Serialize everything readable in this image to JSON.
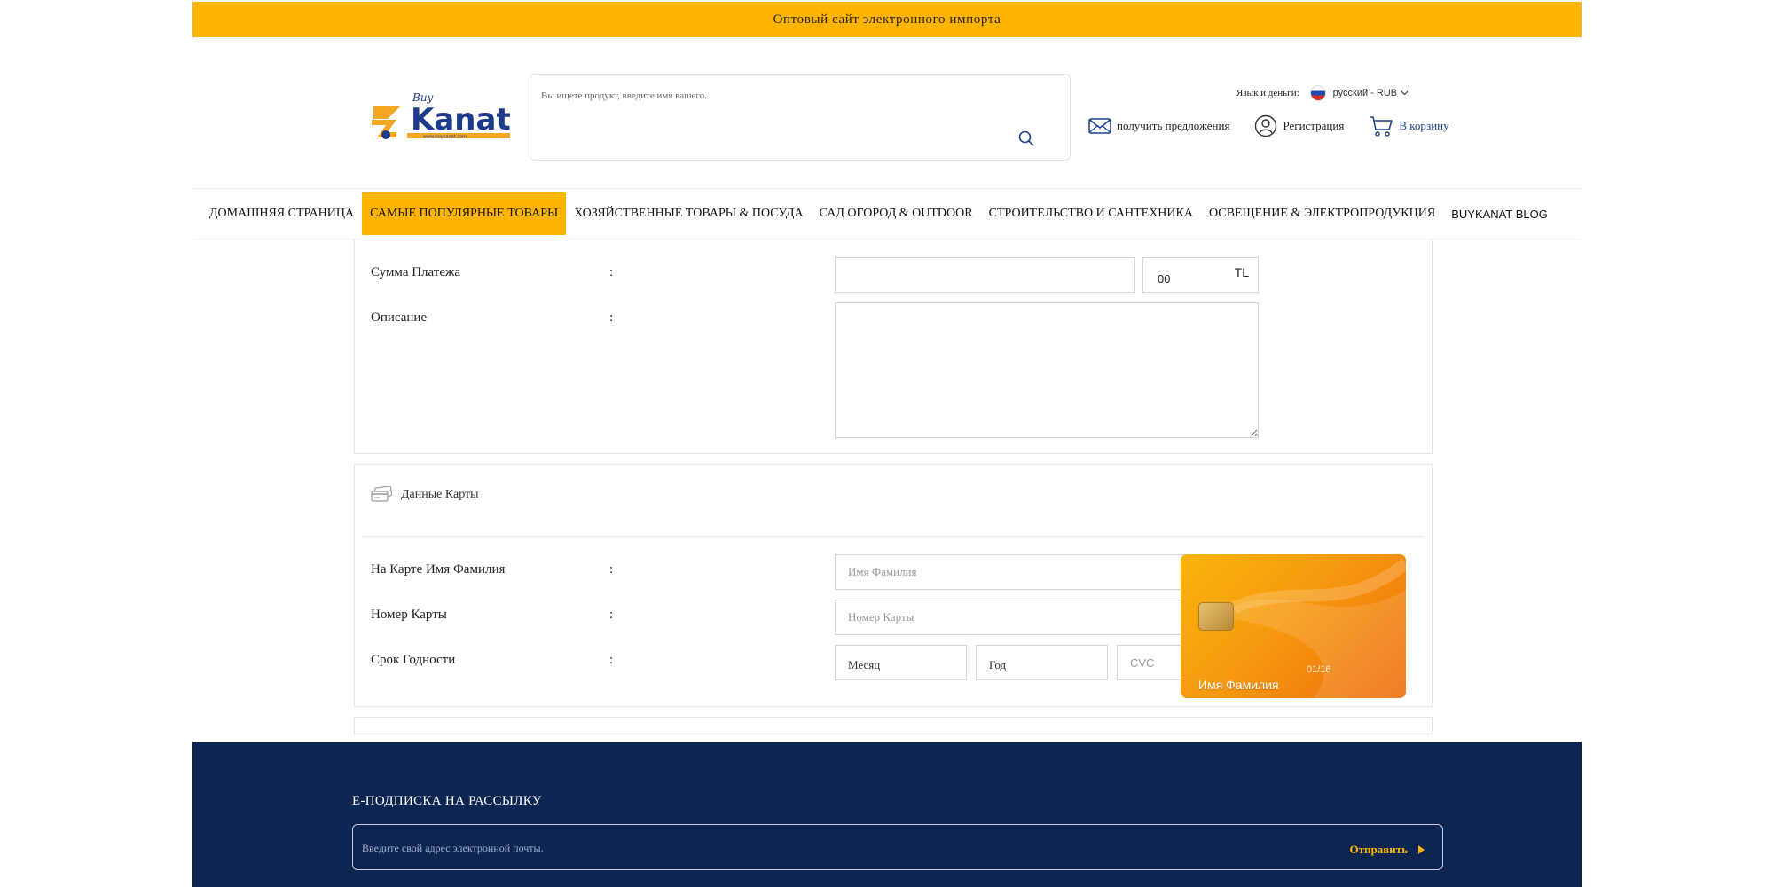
{
  "topbar": {
    "text": "Оптовый сайт электронного импорта"
  },
  "logo": {
    "buy": "Buy",
    "name": "Kanat",
    "site": "www.buykanat.com"
  },
  "search": {
    "placeholder": "Вы ищете продукт, введите имя вашего."
  },
  "lang": {
    "label": "Язык и деньги:",
    "current": "русский - RUB"
  },
  "header_links": {
    "offers": "получить предложения",
    "register": "Регистрация",
    "cart": "В корзину"
  },
  "nav": {
    "items": [
      "ДОМАШНЯЯ СТРАНИЦА",
      "САМЫЕ ПОПУЛЯРНЫЕ ТОВАРЫ",
      "ХОЗЯЙСТВЕННЫЕ ТОВАРЫ & ПОСУДА",
      "САД ОГОРОД & OUTDOOR",
      "СТРОИТЕЛЬСТВО И САНТЕХНИКА",
      "ОСВЕЩЕНИЕ & ЭЛЕКТРОПРОДУКЦИЯ",
      "BUYKANAT BLOG"
    ]
  },
  "payment": {
    "amount_label": "Сумма Платежа",
    "colon": ":",
    "amount_value": "",
    "cents_value": "00",
    "currency": "TL",
    "description_label": "Описание",
    "description_value": ""
  },
  "card": {
    "section_title": "Данные Карты",
    "name_label": "На Карте Имя Фамилия",
    "name_placeholder": "Имя Фамилия",
    "number_label": "Номер Карты",
    "number_placeholder": "Номер Карты",
    "expiry_label": "Срок Годности",
    "month_value": "Месяц",
    "year_value": "Год",
    "cvc_placeholder": "CVC",
    "preview_expiry": "01/16",
    "preview_name": "Имя Фамилия"
  },
  "footer": {
    "title": "E-ПОДПИСКА НА РАССЫЛКУ",
    "email_placeholder": "Введите свой адрес электронной почты.",
    "submit": "Отправить"
  },
  "colors": {
    "accent": "#ffb400",
    "navy": "#0c2551",
    "link_blue": "#1e3f8a"
  }
}
